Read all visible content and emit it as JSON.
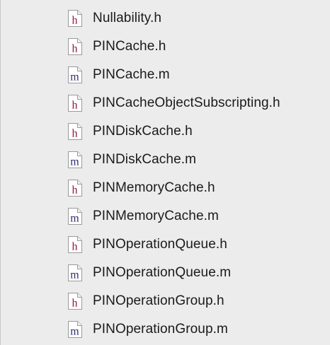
{
  "colors": {
    "background": "#ececec",
    "text": "#1a1a1a",
    "icon_border": "#9a9a9a",
    "header_letter": "#8b1a3a",
    "implementation_letter": "#2c2c6a"
  },
  "files": [
    {
      "name": "Nullability.h",
      "letter": "h",
      "icon": "header-file-icon"
    },
    {
      "name": "PINCache.h",
      "letter": "h",
      "icon": "header-file-icon"
    },
    {
      "name": "PINCache.m",
      "letter": "m",
      "icon": "implementation-file-icon"
    },
    {
      "name": "PINCacheObjectSubscripting.h",
      "letter": "h",
      "icon": "header-file-icon"
    },
    {
      "name": "PINDiskCache.h",
      "letter": "h",
      "icon": "header-file-icon"
    },
    {
      "name": "PINDiskCache.m",
      "letter": "m",
      "icon": "implementation-file-icon"
    },
    {
      "name": "PINMemoryCache.h",
      "letter": "h",
      "icon": "header-file-icon"
    },
    {
      "name": "PINMemoryCache.m",
      "letter": "m",
      "icon": "implementation-file-icon"
    },
    {
      "name": "PINOperationQueue.h",
      "letter": "h",
      "icon": "header-file-icon"
    },
    {
      "name": "PINOperationQueue.m",
      "letter": "m",
      "icon": "implementation-file-icon"
    },
    {
      "name": "PINOperationGroup.h",
      "letter": "h",
      "icon": "header-file-icon"
    },
    {
      "name": "PINOperationGroup.m",
      "letter": "m",
      "icon": "implementation-file-icon"
    }
  ]
}
